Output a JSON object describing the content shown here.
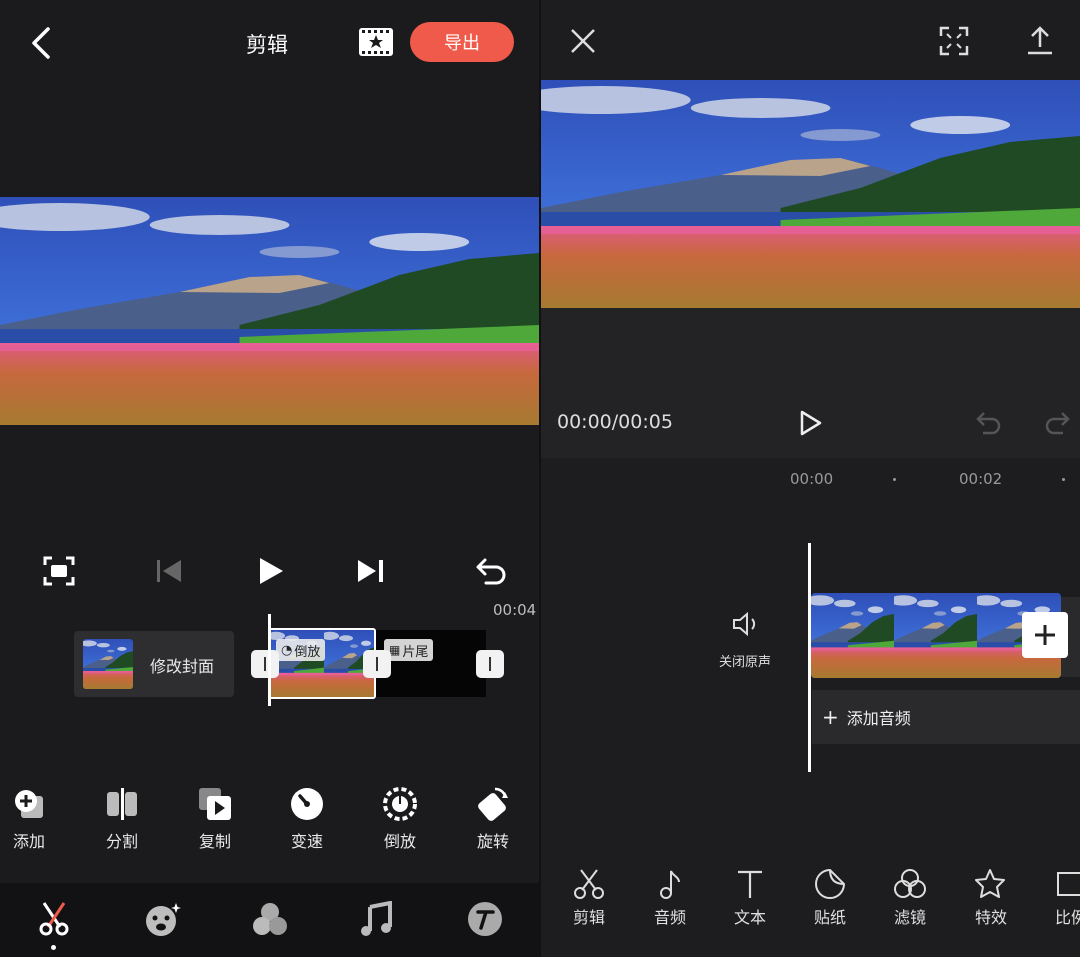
{
  "left_header": {
    "title": "剪辑",
    "export_label": "导出"
  },
  "left_player": {
    "duration": "00:04"
  },
  "left_timeline": {
    "cover_label": "修改封面",
    "reverse_badge": "倒放",
    "ending_badge": "片尾"
  },
  "left_tools": [
    {
      "label": "添加",
      "icon": "add-clip-icon"
    },
    {
      "label": "分割",
      "icon": "split-icon"
    },
    {
      "label": "复制",
      "icon": "copy-icon"
    },
    {
      "label": "变速",
      "icon": "speed-icon"
    },
    {
      "label": "倒放",
      "icon": "reverse-icon"
    },
    {
      "label": "旋转",
      "icon": "rotate-icon"
    }
  ],
  "left_tabs": [
    {
      "icon": "scissors-icon",
      "active": true
    },
    {
      "icon": "sticker-face-icon"
    },
    {
      "icon": "filter-circles-icon"
    },
    {
      "icon": "music-note-icon"
    },
    {
      "icon": "text-t-icon"
    }
  ],
  "right_player": {
    "time": "00:00/00:05"
  },
  "right_timeline": {
    "ruler": [
      "00:00",
      "00:02"
    ],
    "mute_label": "关闭原声",
    "add_audio": "添加音频"
  },
  "right_tools": [
    {
      "label": "剪辑",
      "icon": "scissors-icon"
    },
    {
      "label": "音频",
      "icon": "music-note-icon"
    },
    {
      "label": "文本",
      "icon": "text-icon"
    },
    {
      "label": "贴纸",
      "icon": "sticker-icon"
    },
    {
      "label": "滤镜",
      "icon": "filter-icon"
    },
    {
      "label": "特效",
      "icon": "effects-star-icon"
    },
    {
      "label": "比例",
      "icon": "ratio-icon"
    }
  ],
  "colors": {
    "accent": "#f05a4a",
    "background": "#1b1b1d",
    "bottom_bar": "#121214"
  }
}
